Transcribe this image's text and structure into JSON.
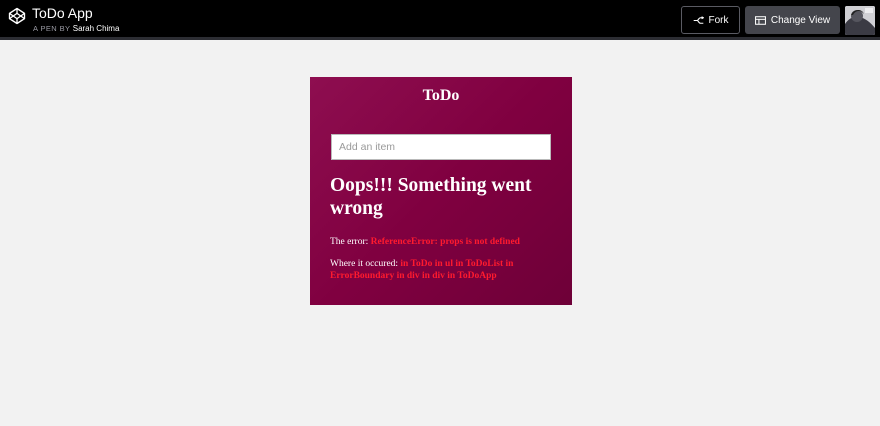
{
  "header": {
    "app_title": "ToDo App",
    "byline_prefix": "A PEN BY",
    "author": "Sarah Chima",
    "fork_label": "Fork",
    "change_view_label": "Change View",
    "icons": {
      "logo": "codepen-logo-icon",
      "fork": "fork-icon",
      "change_view": "layout-icon"
    }
  },
  "todo": {
    "title": "ToDo",
    "input_placeholder": "Add an item",
    "input_value": "",
    "error_heading": "Oops!!! Something went wrong",
    "error_label": "The error:",
    "error_value": "ReferenceError: props is not defined",
    "where_label": "Where it occured:",
    "where_value": "in ToDo in ul in ToDoList in ErrorBoundary in div in div in ToDoApp"
  },
  "colors": {
    "topbar": "#000000",
    "card_gradient_start": "#8e0e50",
    "card_gradient_end": "#6e0038",
    "error_text": "#ff1a2e",
    "page_bg": "#f2f2f2"
  }
}
